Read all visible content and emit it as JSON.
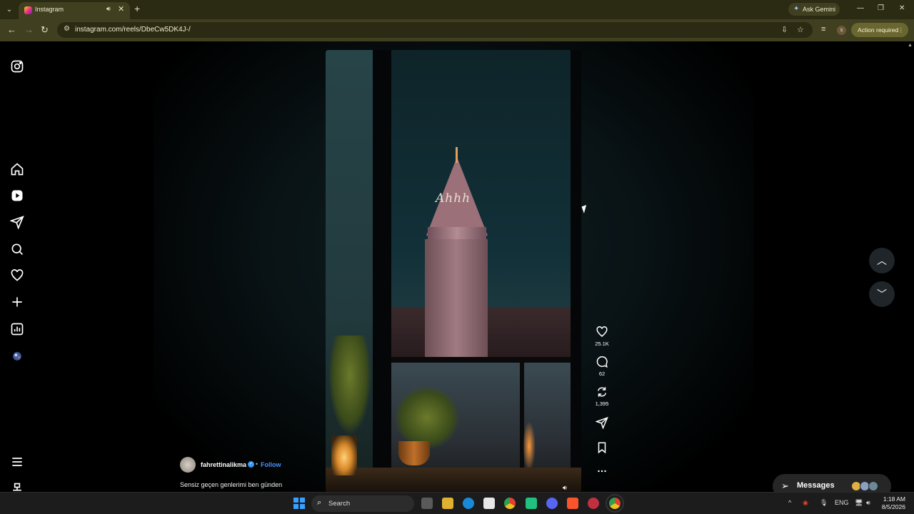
{
  "browser": {
    "tab_title": "Instagram",
    "url": "instagram.com/reels/DbeCw5DK4J-/",
    "ask_gemini": "Ask Gemini",
    "action_required": "Action required",
    "profile_initial": "s"
  },
  "reel": {
    "overlay_text": "Ahhh",
    "likes": "25.1K",
    "comments": "62",
    "reposts": "1,395",
    "author": "fahrettinalikma",
    "follow": "Follow",
    "caption": "Sensiz geçen genlerimi ben günden",
    "separator": "•"
  },
  "messages": {
    "label": "Messages"
  },
  "taskbar": {
    "search": "Search",
    "language": "ENG",
    "time": "1:18 AM",
    "date": "8/5/2026"
  },
  "colors": {
    "browser_frame": "#403f20",
    "tab_strip": "#2b2a12",
    "follow_link": "#4a90ff",
    "verified": "#3897f0"
  },
  "icons": {
    "sidebar": [
      "instagram-icon",
      "home-icon",
      "reels-icon",
      "messages-icon",
      "search-icon",
      "notifications-icon",
      "create-icon",
      "dashboard-icon",
      "profile-avatar",
      "menu-icon",
      "more-icon"
    ],
    "actions": [
      "like-icon",
      "comment-icon",
      "repost-icon",
      "share-icon",
      "save-icon",
      "more-options-icon"
    ]
  }
}
